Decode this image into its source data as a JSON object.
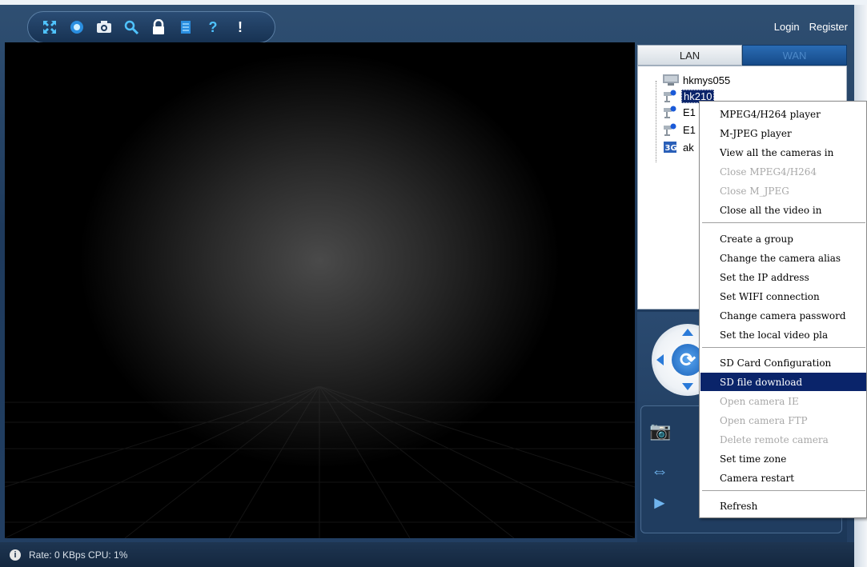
{
  "toolbar": {
    "buttons": [
      {
        "icon": "fullscreen-icon"
      },
      {
        "icon": "record-icon"
      },
      {
        "icon": "camera-icon"
      },
      {
        "icon": "search-icon"
      },
      {
        "icon": "lock-icon"
      },
      {
        "icon": "document-icon"
      },
      {
        "icon": "help-icon",
        "label": "?"
      },
      {
        "icon": "info-icon",
        "label": "!"
      }
    ]
  },
  "auth": {
    "login": "Login",
    "register": "Register"
  },
  "tabs": {
    "lan": "LAN",
    "wan": "WAN"
  },
  "tree": {
    "items": [
      {
        "label": "hkmys055",
        "icon": "pc-icon"
      },
      {
        "label": "hk210",
        "icon": "camera-icon",
        "selected": true
      },
      {
        "label": "E1",
        "icon": "camera-icon"
      },
      {
        "label": "E1",
        "icon": "camera-icon"
      },
      {
        "label": "ak",
        "icon": "3g-icon"
      }
    ]
  },
  "context_menu": {
    "items": [
      {
        "label": "MPEG4/H264 player",
        "enabled": true
      },
      {
        "label": "M-JPEG player",
        "enabled": true
      },
      {
        "label": "View all the cameras in",
        "enabled": true
      },
      {
        "label": "Close MPEG4/H264",
        "enabled": false
      },
      {
        "label": "Close M_JPEG",
        "enabled": false
      },
      {
        "label": "Close all the video in",
        "enabled": true
      },
      {
        "label": "Create a group",
        "enabled": true
      },
      {
        "label": "Change the camera alias",
        "enabled": true
      },
      {
        "label": "Set the IP address",
        "enabled": true
      },
      {
        "label": "Set WIFI connection",
        "enabled": true
      },
      {
        "label": "Change camera password",
        "enabled": true
      },
      {
        "label": "Set the local video pla",
        "enabled": true
      },
      {
        "label": "SD Card Configuration",
        "enabled": true
      },
      {
        "label": "SD file download",
        "enabled": true,
        "highlighted": true
      },
      {
        "label": "Open camera IE",
        "enabled": false
      },
      {
        "label": "Open camera FTP",
        "enabled": false
      },
      {
        "label": "Delete remote camera",
        "enabled": false
      },
      {
        "label": "Set time zone",
        "enabled": true
      },
      {
        "label": "Camera restart",
        "enabled": true
      },
      {
        "label": "Refresh",
        "enabled": true
      }
    ]
  },
  "status": {
    "icon": "info-icon",
    "text": "Rate: 0 KBps  CPU:  1%"
  },
  "colors": {
    "accent": "#4fc3ff",
    "selection": "#0a246a",
    "frame": "#1e3a5c"
  }
}
